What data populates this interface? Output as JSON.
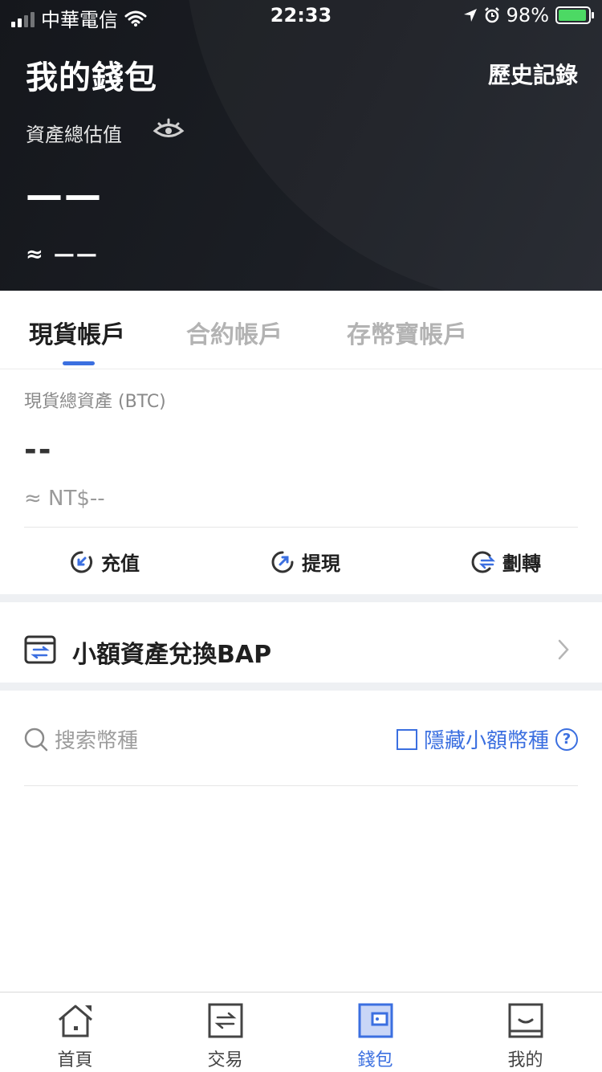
{
  "status_bar": {
    "carrier": "中華電信",
    "time": "22:33",
    "battery": "98%",
    "battery_level": 0.98
  },
  "header": {
    "title": "我的錢包",
    "history_link": "歷史記錄",
    "estimate_label": "資產總估值",
    "total_value": "——",
    "approx_value": "≈ ——"
  },
  "tabs": [
    {
      "label": "現貨帳戶",
      "active": true
    },
    {
      "label": "合約帳戶",
      "active": false
    },
    {
      "label": "存幣寶帳戶",
      "active": false
    }
  ],
  "spot": {
    "label": "現貨總資產 (BTC)",
    "value": "--",
    "approx": "≈ NT$--"
  },
  "actions": [
    {
      "label": "充值",
      "icon": "deposit-arrow-icon"
    },
    {
      "label": "提現",
      "icon": "withdraw-arrow-icon"
    },
    {
      "label": "劃轉",
      "icon": "transfer-icon"
    }
  ],
  "bap": {
    "label": "小額資產兌換BAP"
  },
  "filter": {
    "search_placeholder": "搜索幣種",
    "hide_small_label": "隱藏小額幣種"
  },
  "bottom_nav": [
    {
      "label": "首頁",
      "icon": "home-icon",
      "active": false
    },
    {
      "label": "交易",
      "icon": "trade-icon",
      "active": false
    },
    {
      "label": "錢包",
      "icon": "wallet-icon",
      "active": true
    },
    {
      "label": "我的",
      "icon": "profile-icon",
      "active": false
    }
  ],
  "colors": {
    "accent": "#3b6fe0",
    "header_bg": "#1b1e24",
    "battery_green": "#4cd964"
  }
}
